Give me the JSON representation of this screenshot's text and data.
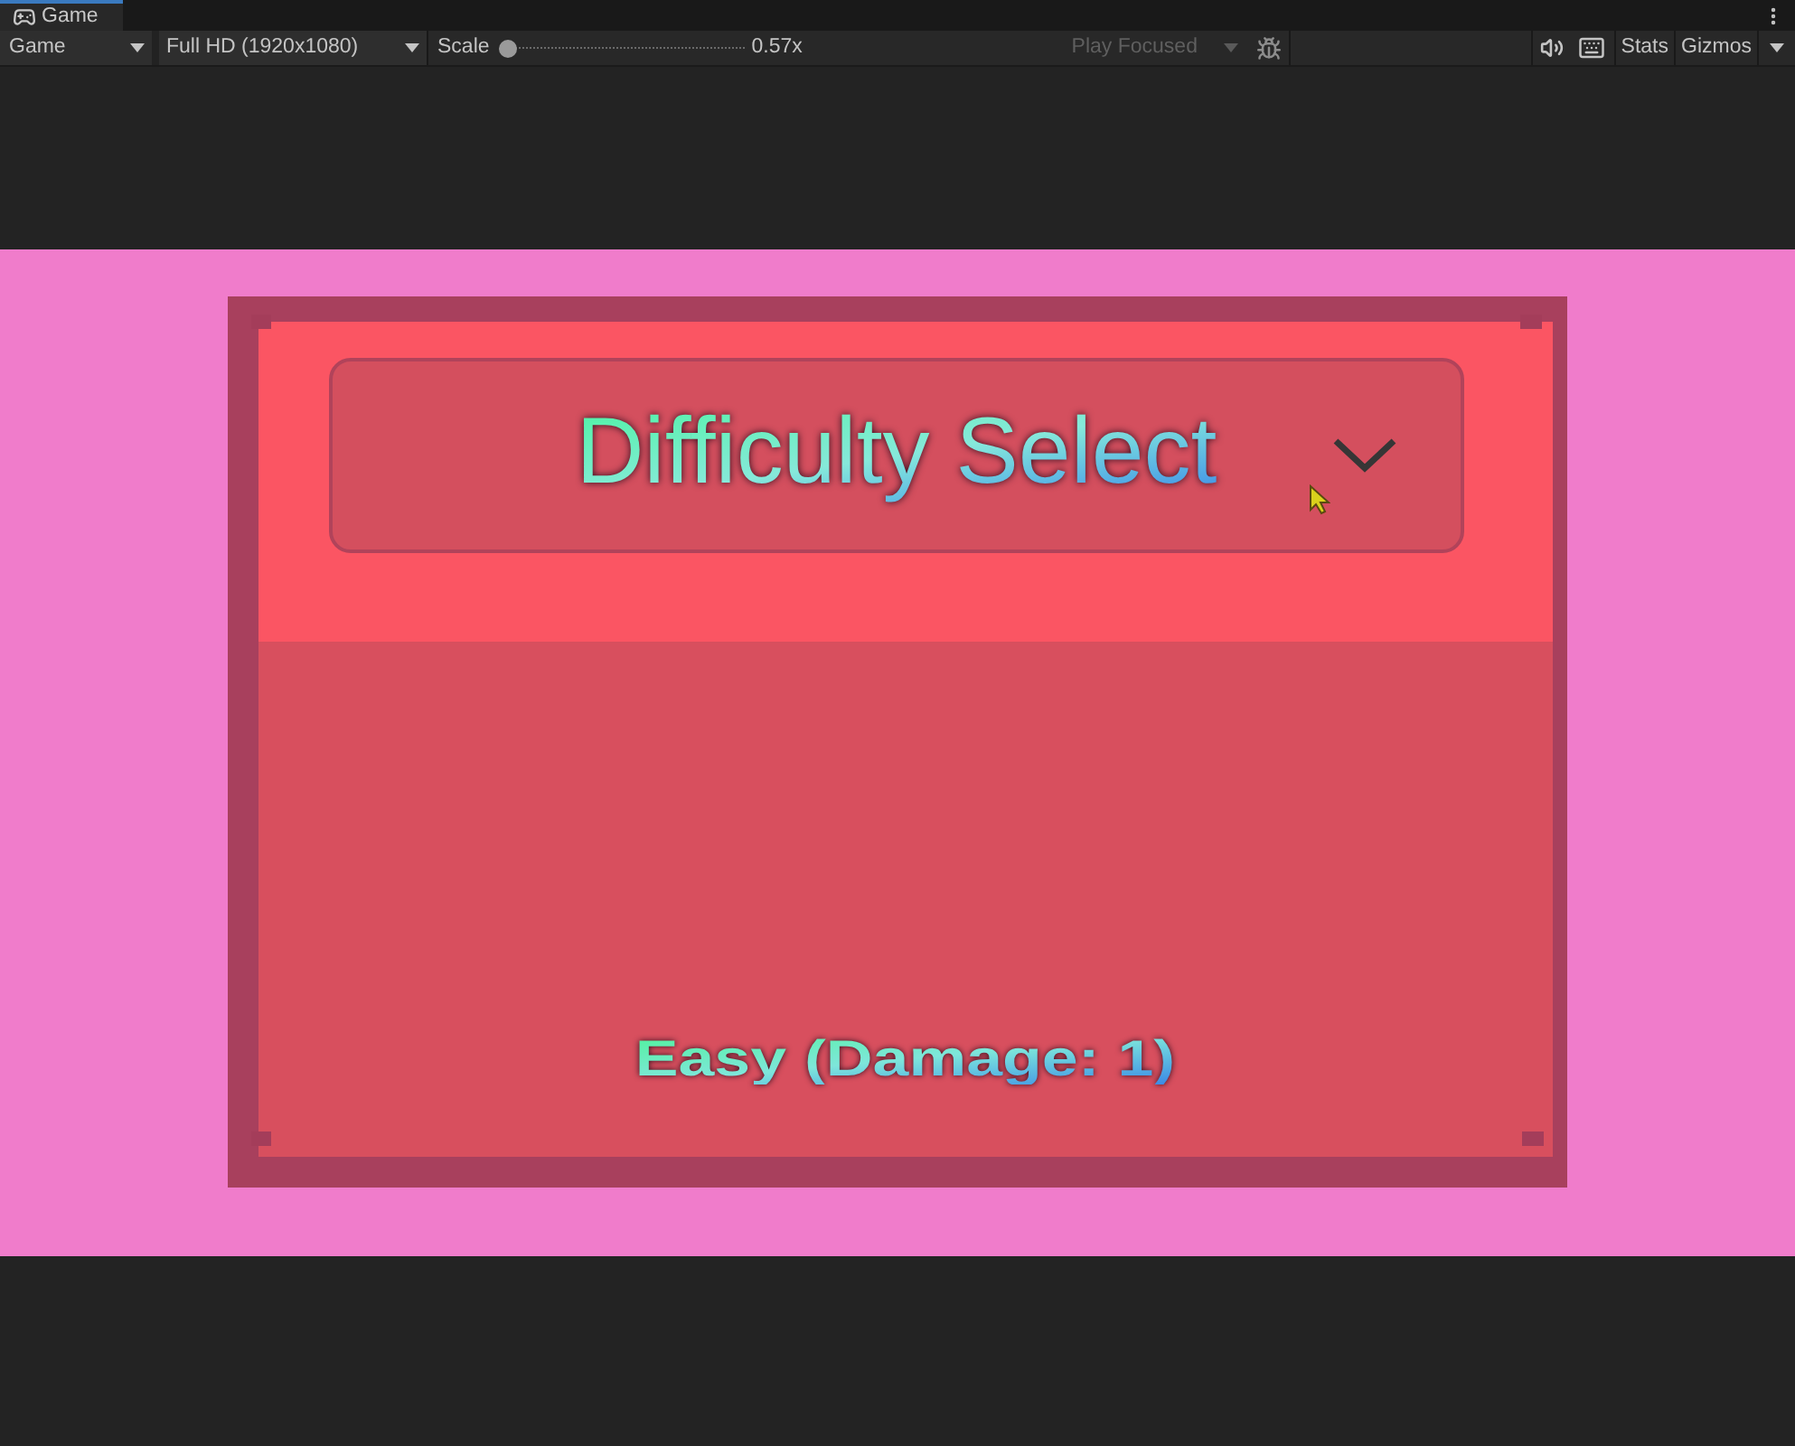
{
  "window": {
    "tabs": [
      {
        "label": "Game",
        "selected": true
      }
    ]
  },
  "toolbar": {
    "display": {
      "label": "Game"
    },
    "resolution": {
      "label": "Full HD (1920x1080)"
    },
    "scale": {
      "label": "Scale",
      "level": 0,
      "reading": "0.57x"
    },
    "play_mode": {
      "label": "Play Focused",
      "disabled": true
    },
    "toggles": [
      "Stats",
      "Gizmos"
    ]
  },
  "game_view": {
    "dropdown": {
      "label": "Difficulty Select",
      "expanded": false
    },
    "selected_option": "Easy (Damage: 1)"
  }
}
